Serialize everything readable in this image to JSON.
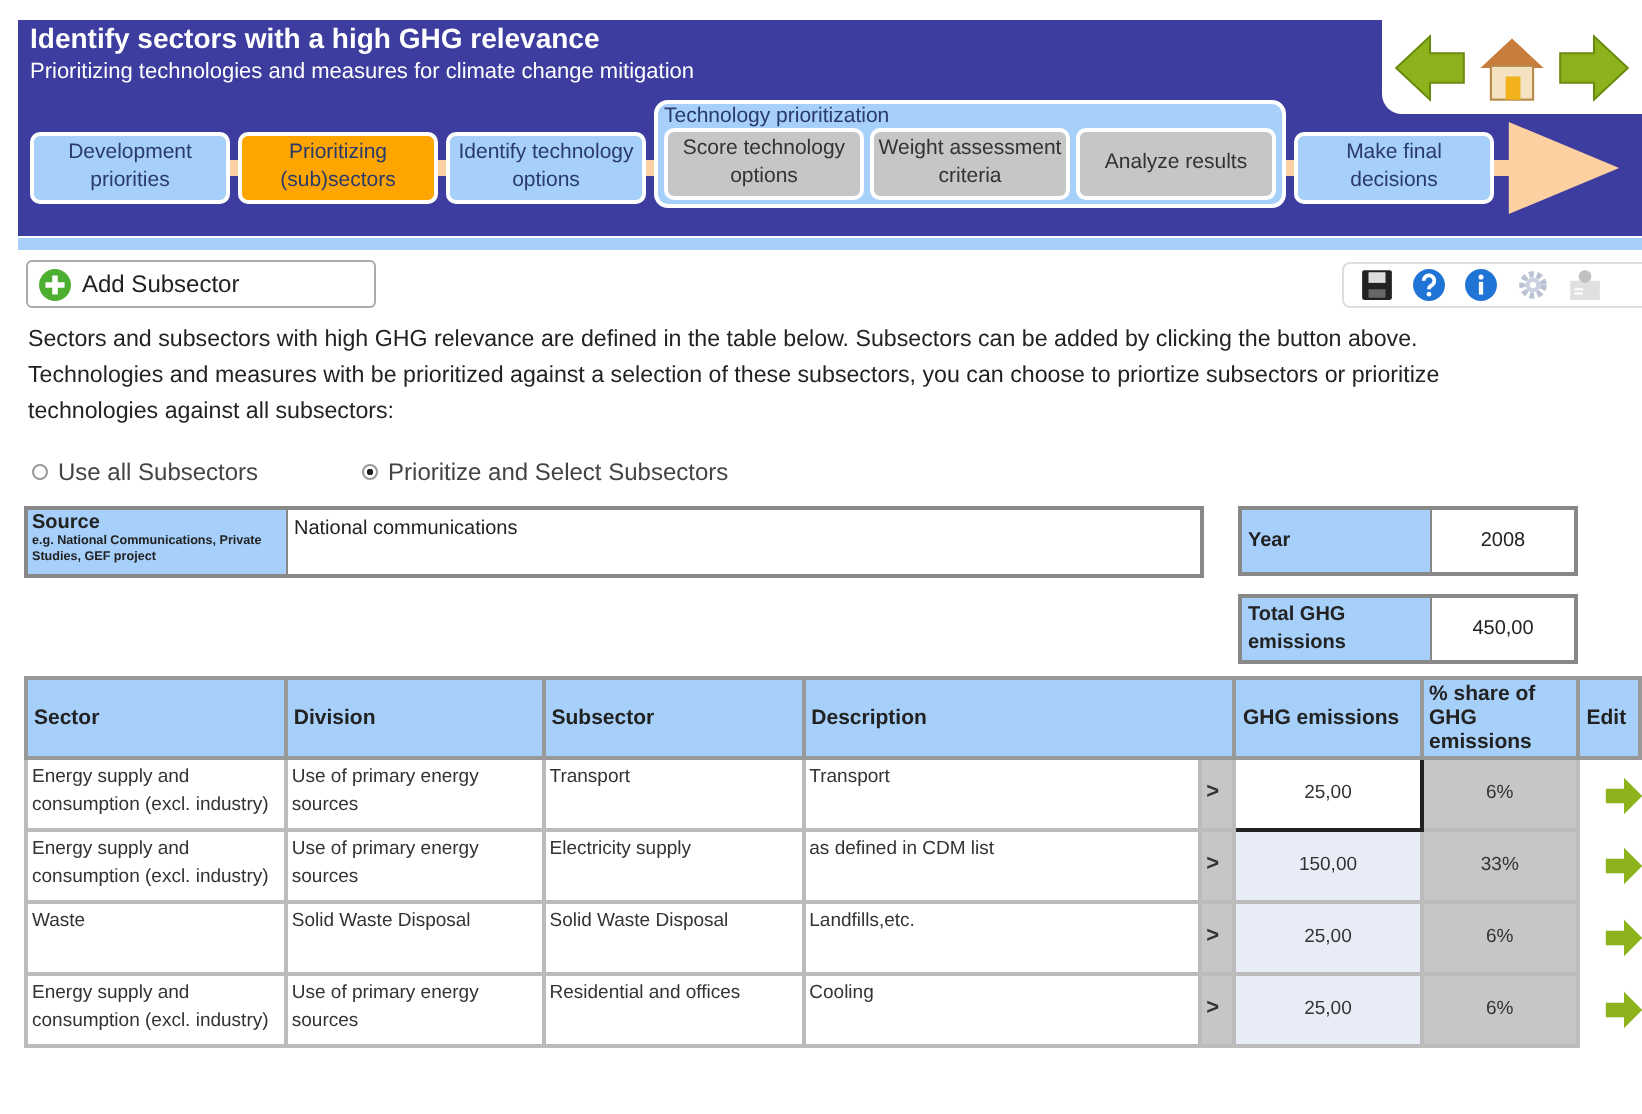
{
  "header": {
    "title": "Identify sectors with a high GHG relevance",
    "subtitle": "Prioritizing technologies and measures for climate change mitigation"
  },
  "steps": [
    {
      "kind": "step",
      "label": "Development priorities",
      "selected": false,
      "disabled": false
    },
    {
      "kind": "step",
      "label": "Prioritizing (sub)sectors",
      "selected": true,
      "disabled": false
    },
    {
      "kind": "step",
      "label": "Identify technology options",
      "selected": false,
      "disabled": false
    },
    {
      "kind": "group",
      "label": "Technology prioritization",
      "children": [
        {
          "kind": "step",
          "label": "Score  technology options",
          "selected": false,
          "disabled": true
        },
        {
          "kind": "step",
          "label": "Weight assessment criteria",
          "selected": false,
          "disabled": true
        },
        {
          "kind": "step",
          "label": "Analyze results",
          "selected": false,
          "disabled": true
        }
      ]
    },
    {
      "kind": "step",
      "label": "Make final decisions",
      "selected": false,
      "disabled": false
    }
  ],
  "add_button": "Add Subsector",
  "toolbar": [
    {
      "kind": "save",
      "disabled": false
    },
    {
      "kind": "help",
      "disabled": false
    },
    {
      "kind": "info",
      "disabled": false
    },
    {
      "kind": "settings",
      "disabled": true
    },
    {
      "kind": "user",
      "disabled": true
    }
  ],
  "intro": "Sectors and subsectors with high GHG relevance are defined in the table below. Subsectors can be added by clicking the button above. Technologies and measures with be prioritized against a selection of these subsectors, you can choose to priortize subsectors or prioritize technologies against all subsectors:",
  "radios": [
    {
      "label": "Use all Subsectors",
      "selected": false
    },
    {
      "label": "Prioritize and Select Subsectors",
      "selected": true
    }
  ],
  "source": {
    "label": "Source",
    "hint": "e.g. National Communications, Private Studies, GEF project",
    "value": "National communications"
  },
  "year": {
    "label": "Year",
    "value": "2008"
  },
  "total": {
    "label": "Total GHG emissions",
    "value": "450,00"
  },
  "table": {
    "columns": [
      "Sector",
      "Division",
      "Subsector",
      "Description",
      "GHG emissions",
      "% share of GHG emissions",
      "Edit"
    ],
    "rows": [
      {
        "sector": "Energy supply and consumption (excl. industry)",
        "division": "Use of primary energy sources",
        "subsector": "Transport",
        "description": "Transport",
        "expand": ">",
        "emissions": "25,00",
        "share": "6%",
        "selected": true
      },
      {
        "sector": "Energy supply and consumption (excl. industry)",
        "division": "Use of primary energy sources",
        "subsector": "Electricity supply",
        "description": "as defined in CDM list",
        "expand": ">",
        "emissions": "150,00",
        "share": "33%",
        "selected": false
      },
      {
        "sector": "Waste",
        "division": "Solid Waste Disposal",
        "subsector": "Solid Waste Disposal",
        "description": "Landfills,etc.",
        "expand": ">",
        "emissions": "25,00",
        "share": "6%",
        "selected": false
      },
      {
        "sector": "Energy supply and consumption (excl. industry)",
        "division": "Use of primary energy sources",
        "subsector": "Residential and offices",
        "description": "Cooling",
        "expand": ">",
        "emissions": "25,00",
        "share": "6%",
        "selected": false
      }
    ]
  }
}
